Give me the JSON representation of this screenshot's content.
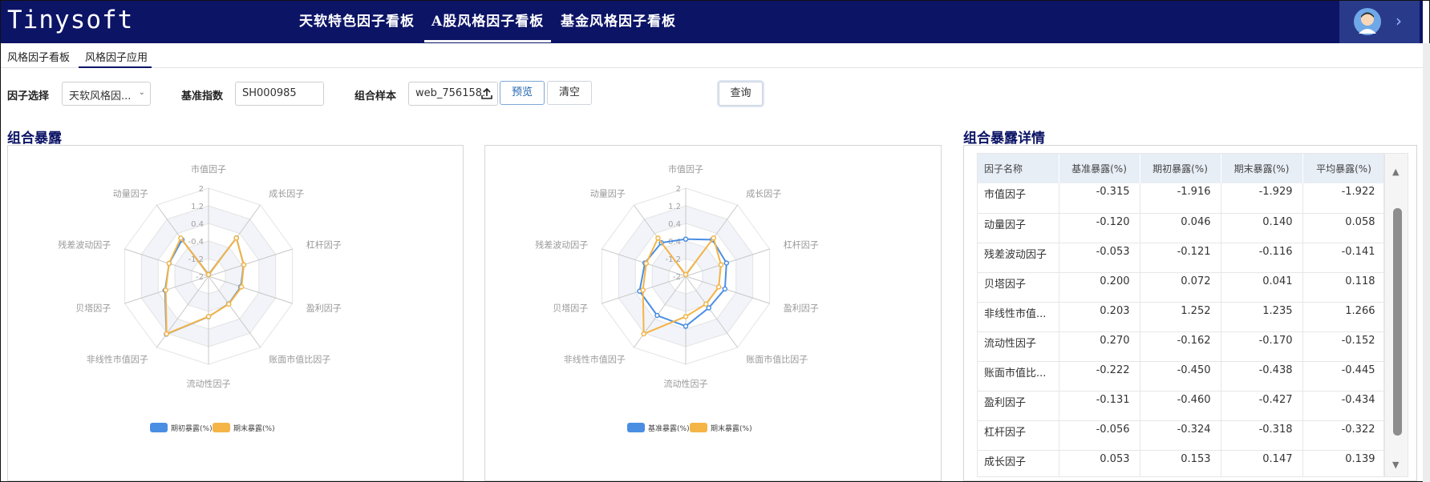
{
  "header": {
    "logo": "Tinysoft",
    "nav": [
      "天软特色因子看板",
      "A股风格因子看板",
      "基金风格因子看板"
    ],
    "active_nav": "A股风格因子看板",
    "user_icon": "avatar-icon",
    "expand_icon": "chevron-right-icon"
  },
  "subtabs": [
    "风格因子看板",
    "风格因子应用"
  ],
  "filters": {
    "factor_label": "因子选择",
    "factor_value": "天软风格因...",
    "benchmark_label": "基准指数",
    "benchmark_value": "SH000985",
    "portfolio_label": "组合样本",
    "portfolio_value": "web_756158:",
    "preview": "预览",
    "clear": "清空",
    "query": "查询"
  },
  "sections": {
    "exposure": "组合暴露",
    "detail": "组合暴露详情"
  },
  "chart_data": [
    {
      "type": "radar",
      "axes": [
        "市值因子",
        "成长因子",
        "杠杆因子",
        "盈利因子",
        "账面市值比因子",
        "流动性因子",
        "非线性市值因子",
        "贝塔因子",
        "残差波动因子",
        "动量因子"
      ],
      "ticks": [
        "2",
        "1.2",
        "0.4",
        "-0.4",
        "-1.2",
        "-2"
      ],
      "range": [
        -2,
        2
      ],
      "series": [
        {
          "name": "期初暴露(%)",
          "color": "#4a8ee3",
          "values": [
            -1.916,
            0.153,
            -0.324,
            -0.46,
            -0.45,
            -0.162,
            1.252,
            0.072,
            -0.121,
            0.046
          ]
        },
        {
          "name": "期末暴露(%)",
          "color": "#f4b446",
          "values": [
            -1.929,
            0.147,
            -0.318,
            -0.427,
            -0.438,
            -0.17,
            1.235,
            0.041,
            -0.116,
            0.14
          ]
        }
      ]
    },
    {
      "type": "radar",
      "axes": [
        "市值因子",
        "成长因子",
        "杠杆因子",
        "盈利因子",
        "账面市值比因子",
        "流动性因子",
        "非线性市值因子",
        "贝塔因子",
        "残差波动因子",
        "动量因子"
      ],
      "ticks": [
        "2",
        "1.2",
        "0.4",
        "-0.4",
        "-1.2",
        "-2"
      ],
      "range": [
        -2,
        2
      ],
      "series": [
        {
          "name": "基准暴露(%)",
          "color": "#4a8ee3",
          "values": [
            -0.315,
            0.053,
            -0.056,
            -0.131,
            -0.222,
            0.27,
            0.203,
            0.2,
            -0.053,
            -0.12
          ]
        },
        {
          "name": "期末暴露(%)",
          "color": "#f4b446",
          "values": [
            -1.929,
            0.147,
            -0.318,
            -0.427,
            -0.438,
            -0.17,
            1.235,
            0.041,
            -0.116,
            0.14
          ]
        }
      ]
    }
  ],
  "table": {
    "columns": [
      "因子名称",
      "基准暴露(%)",
      "期初暴露(%)",
      "期末暴露(%)",
      "平均暴露(%)"
    ],
    "rows": [
      [
        "市值因子",
        "-0.315",
        "-1.916",
        "-1.929",
        "-1.922"
      ],
      [
        "动量因子",
        "-0.120",
        "0.046",
        "0.140",
        "0.058"
      ],
      [
        "残差波动因子",
        "-0.053",
        "-0.121",
        "-0.116",
        "-0.141"
      ],
      [
        "贝塔因子",
        "0.200",
        "0.072",
        "0.041",
        "0.118"
      ],
      [
        "非线性市值...",
        "0.203",
        "1.252",
        "1.235",
        "1.266"
      ],
      [
        "流动性因子",
        "0.270",
        "-0.162",
        "-0.170",
        "-0.152"
      ],
      [
        "账面市值比...",
        "-0.222",
        "-0.450",
        "-0.438",
        "-0.445"
      ],
      [
        "盈利因子",
        "-0.131",
        "-0.460",
        "-0.427",
        "-0.434"
      ],
      [
        "杠杆因子",
        "-0.056",
        "-0.324",
        "-0.318",
        "-0.322"
      ],
      [
        "成长因子",
        "0.053",
        "0.153",
        "0.147",
        "0.139"
      ]
    ]
  }
}
